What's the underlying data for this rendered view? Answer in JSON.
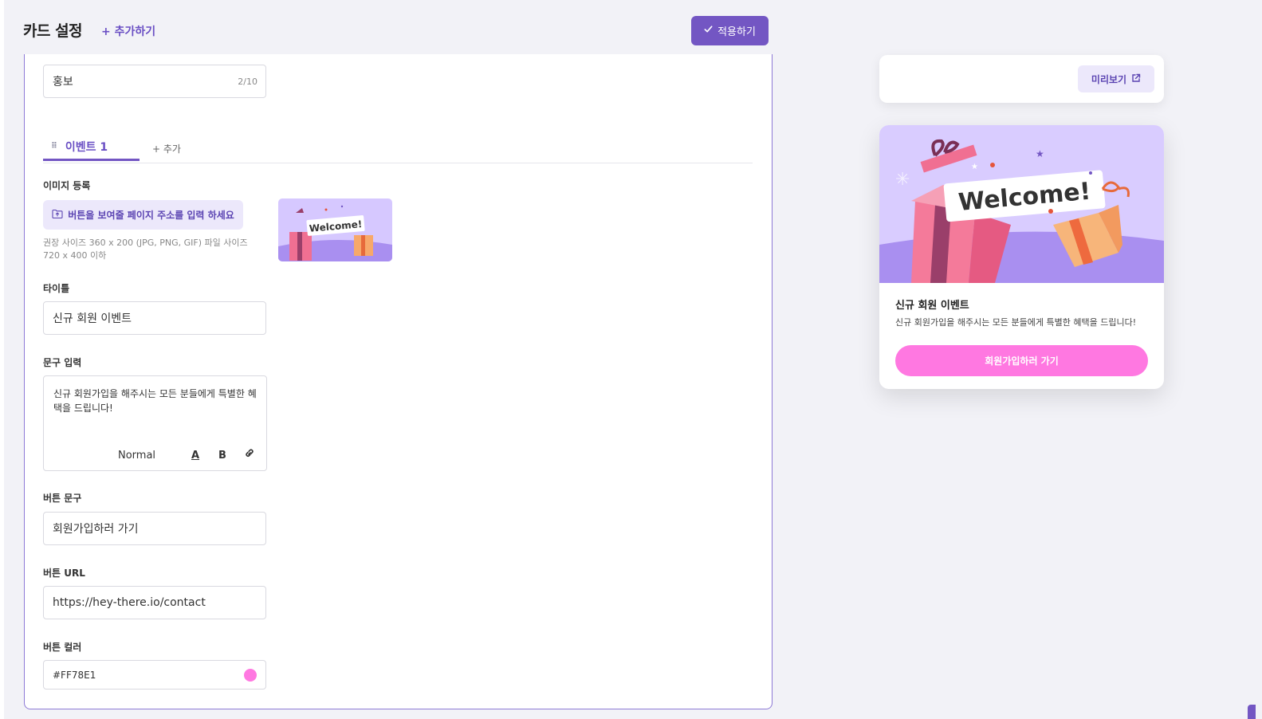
{
  "header": {
    "title": "카드 설정",
    "add_label": "+ 추가하기",
    "apply_label": "적용하기"
  },
  "form": {
    "category_value": "홍보",
    "category_counter": "2/10",
    "tabs": [
      {
        "label": "이벤트 1"
      }
    ],
    "tab_add_label": "+ 추가",
    "image_label": "이미지 등록",
    "upload_label": "버튼을 보여줄 페이지 주소를 입력 하세요",
    "upload_hint": "권장 사이즈 360 x 200 (JPG, PNG, GIF) 파일 사이즈 720 x 400 이하",
    "title_label": "타이틀",
    "title_value": "신규 회원 이벤트",
    "text_label": "문구 입력",
    "text_value": "신규 회원가입을 해주시는 모든 분들에게 특별한 혜택을 드립니다!",
    "toolbar": {
      "format": "Normal"
    },
    "button_text_label": "버튼 문구",
    "button_text_value": "회원가입하러 가기",
    "button_url_label": "버튼 URL",
    "button_url_value": "https://hey-there.io/contact",
    "button_color_label": "버튼 컬러",
    "button_color_value": "#FF78E1"
  },
  "preview": {
    "preview_label": "미리보기",
    "image_text": "Welcome!",
    "thumb_text": "Welcome!",
    "card_title": "신규 회원 이벤트",
    "card_body": "신규 회원가입을 해주시는 모든 분들에게 특별한 혜택을 드립니다!",
    "cta_label": "회원가입하러 가기"
  },
  "colors": {
    "accent": "#7356c3",
    "button": "#FF78E1",
    "background": "#f2f2f7"
  }
}
